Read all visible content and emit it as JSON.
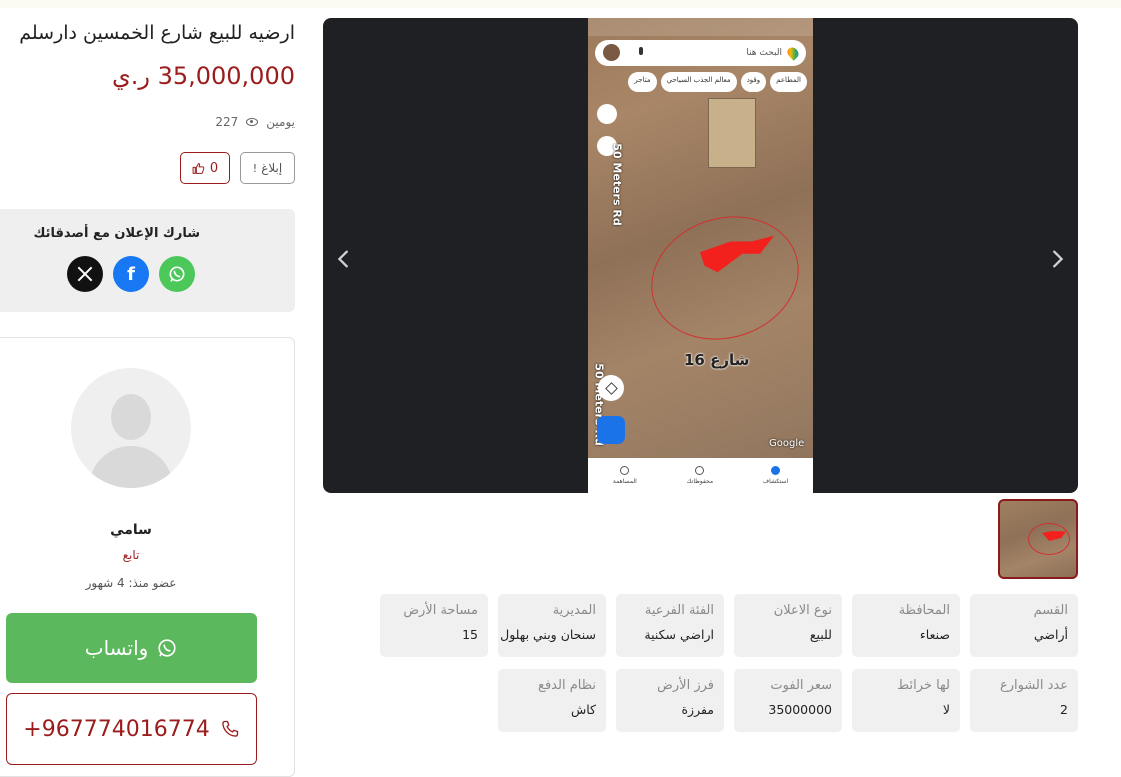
{
  "listing": {
    "title": "ارضيه للبيع شارع الخمسين دارسلم",
    "price": "35,000,000 ر.ي",
    "views": "227",
    "age": "يومين",
    "report_label": "إبلاغ",
    "likes": "0"
  },
  "share": {
    "title": "شارك الإعلان مع أصدقائك",
    "networks": [
      "whatsapp-icon",
      "facebook-icon",
      "x-icon"
    ]
  },
  "seller": {
    "name": "سامي",
    "role": "تابع",
    "member_since": "عضو منذ: 4 شهور",
    "whatsapp_label": "واتساب",
    "phone": "+967774016774"
  },
  "gallery": {
    "map_search_placeholder": "البحث هنا",
    "map_chips": [
      "المطاعم",
      "وقود",
      "معالم الجذب السياحي",
      "متاجر"
    ],
    "map_street_label": "شارع 16",
    "map_road_label": "50 Meters Rd",
    "map_road_label2": "50 Meters Rd",
    "map_watermark": "Google",
    "map_nav": [
      "استكشاف",
      "محفوظاتك",
      "المساهمة"
    ]
  },
  "details": [
    {
      "label": "القسم",
      "value": "أراضي"
    },
    {
      "label": "المحافظة",
      "value": "صنعاء"
    },
    {
      "label": "نوع الاعلان",
      "value": "للبيع"
    },
    {
      "label": "الفئة الفرعية",
      "value": "اراضي سكنية"
    },
    {
      "label": "المديرية",
      "value": "سنحان وبني بهلول"
    },
    {
      "label": "مساحة الأرض",
      "value": "15"
    },
    {
      "label": "عدد الشوارع",
      "value": "2"
    },
    {
      "label": "لها خرائط",
      "value": "لا"
    },
    {
      "label": "سعر الفوت",
      "value": "35000000"
    },
    {
      "label": "فرز الأرض",
      "value": "مفرزة"
    },
    {
      "label": "نظام الدفع",
      "value": "كاش"
    }
  ],
  "colors": {
    "accent": "#9b1c1c",
    "whatsapp": "#5cb85c",
    "gallery_bg": "#1f2023"
  }
}
